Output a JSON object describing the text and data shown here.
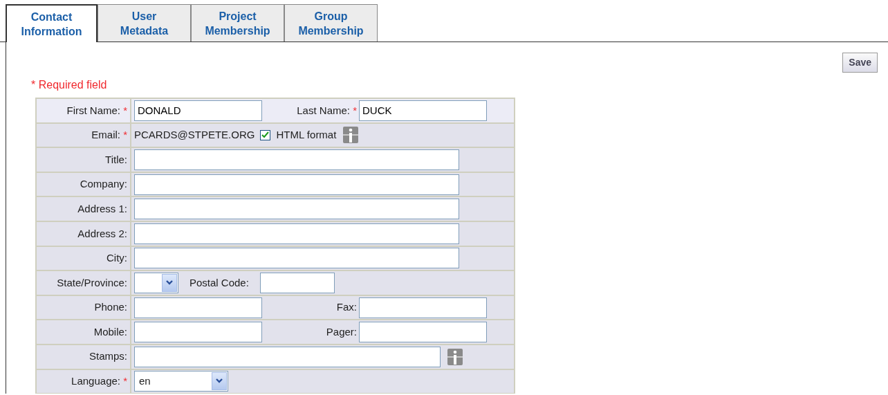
{
  "tabs": [
    {
      "label": "Contact Information",
      "selected": true
    },
    {
      "label": "User Metadata",
      "selected": false
    },
    {
      "label": "Project Membership",
      "selected": false
    },
    {
      "label": "Group Membership",
      "selected": false
    }
  ],
  "save_button": "Save",
  "required_note": "* Required field",
  "rows": [
    {
      "label": "First Name:",
      "required_mark": "*",
      "fields": [
        {
          "kind": "input",
          "value": "DONALD"
        },
        {
          "kind": "label",
          "text": "Last Name:",
          "required_mark": "*"
        },
        {
          "kind": "input",
          "value": "DUCK"
        }
      ]
    },
    {
      "label": "Email:",
      "required_mark": "*",
      "fields": [
        {
          "kind": "text",
          "text": "PCARDS@STPETE.ORG"
        },
        {
          "kind": "checkbox",
          "text": "HTML format",
          "checked": true
        },
        {
          "kind": "info"
        }
      ]
    },
    {
      "label": "Title:",
      "fields": [
        {
          "kind": "input"
        }
      ]
    },
    {
      "label": "Company:",
      "fields": [
        {
          "kind": "input"
        }
      ]
    },
    {
      "label": "Address 1:",
      "fields": [
        {
          "kind": "input"
        }
      ]
    },
    {
      "label": "Address 2:",
      "fields": [
        {
          "kind": "input"
        }
      ]
    },
    {
      "label": "City:",
      "fields": [
        {
          "kind": "input"
        }
      ]
    },
    {
      "label": "State/Province:",
      "fields": [
        {
          "kind": "select"
        },
        {
          "kind": "inline-label",
          "text": "Postal Code:"
        },
        {
          "kind": "input"
        }
      ]
    },
    {
      "label": "Phone:",
      "fields": [
        {
          "kind": "input"
        },
        {
          "kind": "label",
          "text": "Fax:"
        },
        {
          "kind": "input"
        }
      ]
    },
    {
      "label": "Mobile:",
      "fields": [
        {
          "kind": "input"
        },
        {
          "kind": "label",
          "text": "Pager:"
        },
        {
          "kind": "input"
        }
      ]
    },
    {
      "label": "Stamps:",
      "fields": [
        {
          "kind": "input"
        },
        {
          "kind": "info"
        }
      ]
    },
    {
      "label": "Language:",
      "required_mark": "*",
      "fields": [
        {
          "kind": "select",
          "value": "en"
        }
      ]
    }
  ]
}
